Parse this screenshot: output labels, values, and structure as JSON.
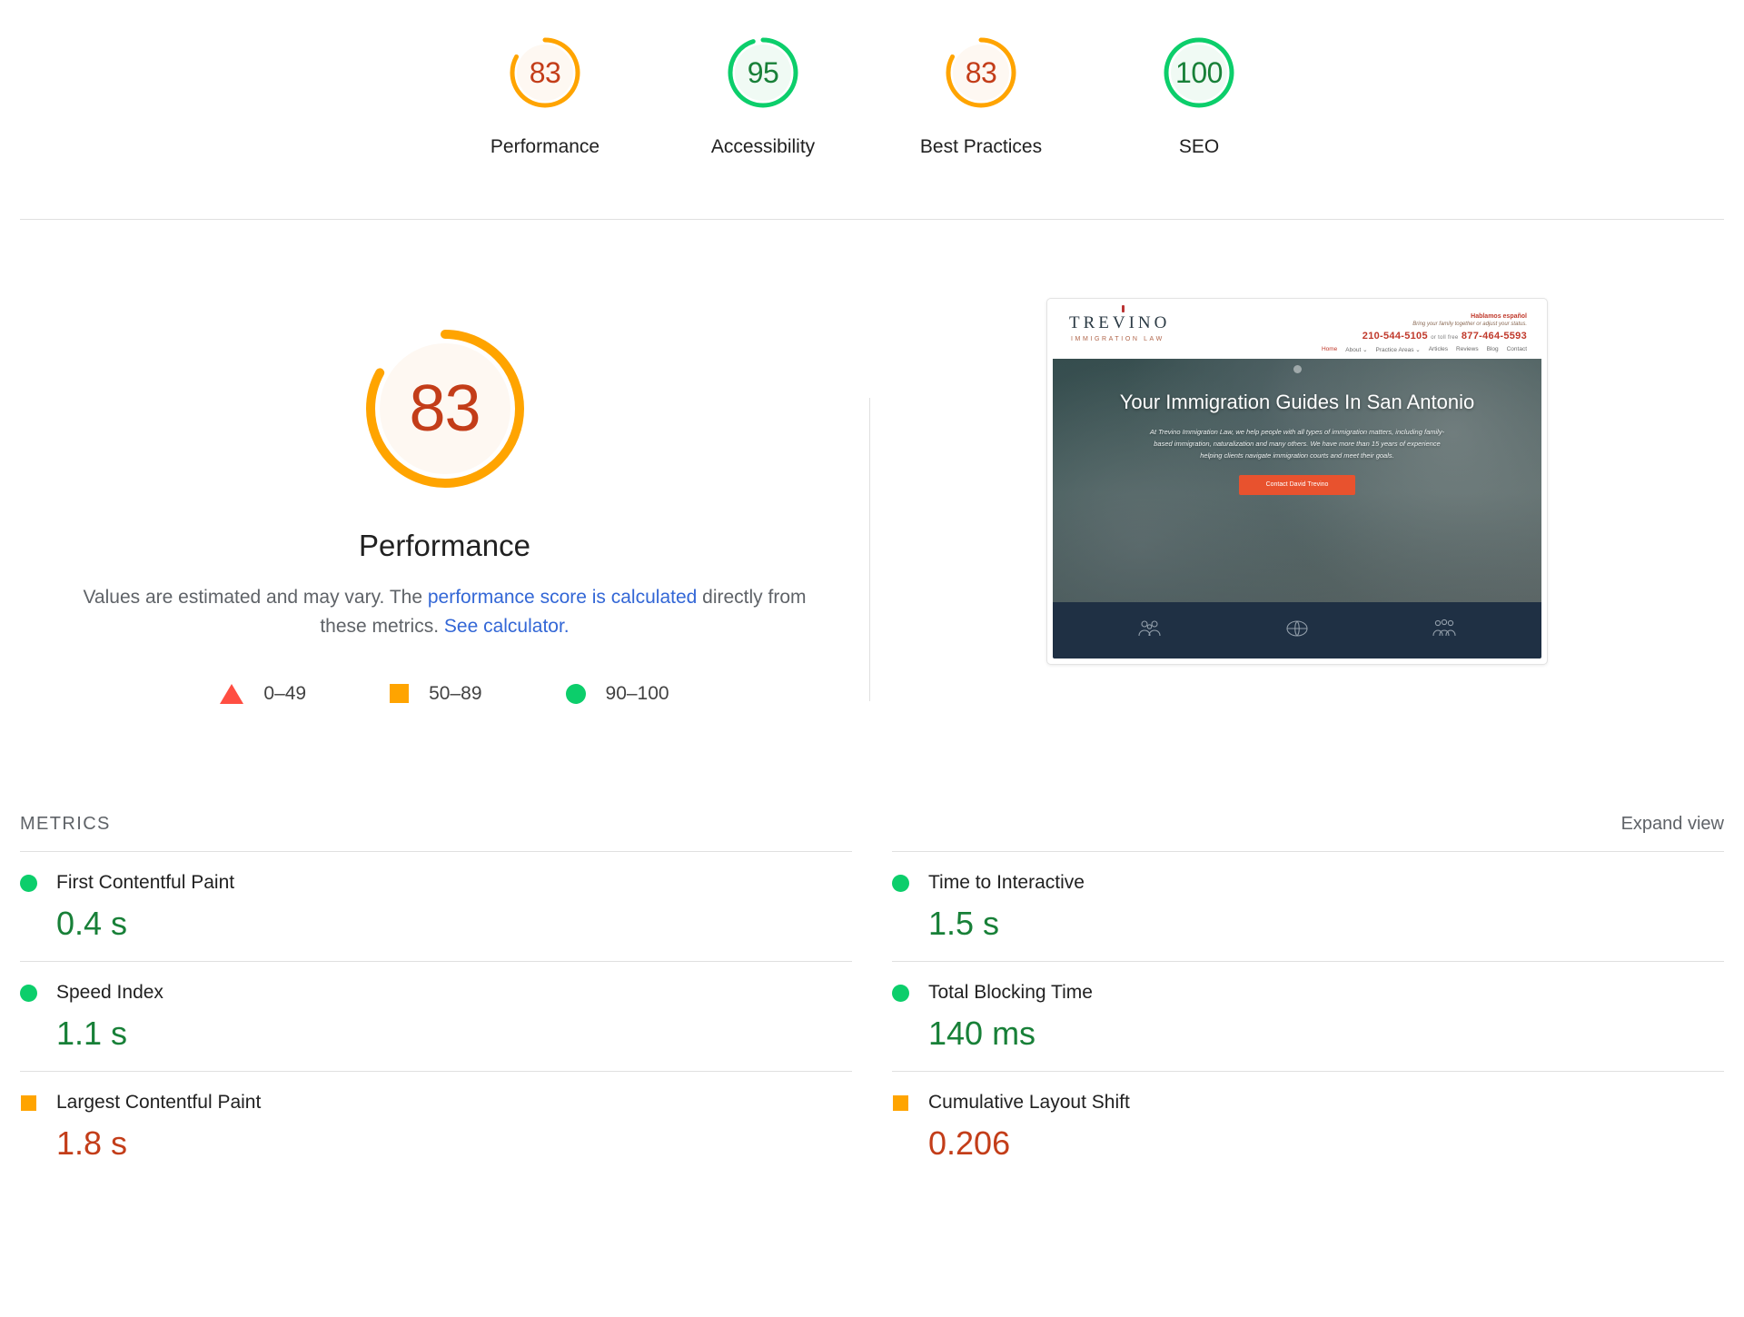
{
  "scores": [
    {
      "value": 83,
      "label": "Performance",
      "status": "average",
      "pct": 83
    },
    {
      "value": 95,
      "label": "Accessibility",
      "status": "pass",
      "pct": 95
    },
    {
      "value": 83,
      "label": "Best Practices",
      "status": "average",
      "pct": 83
    },
    {
      "value": 100,
      "label": "SEO",
      "status": "pass",
      "pct": 100
    }
  ],
  "performance": {
    "value": 83,
    "title": "Performance",
    "desc_part1": "Values are estimated and may vary. The ",
    "link1": "performance score is calculated",
    "desc_part2": " directly from these metrics. ",
    "link2": "See calculator.",
    "legend": [
      {
        "shape": "triangle",
        "range": "0–49",
        "color": "#ff4e42"
      },
      {
        "shape": "square",
        "range": "50–89",
        "color": "#ffa400"
      },
      {
        "shape": "circle",
        "range": "90–100",
        "color": "#0cce6b"
      }
    ]
  },
  "thumbnail": {
    "logo": "TREVINO",
    "logo_sub": "IMMIGRATION LAW",
    "hablamos": "Hablamos español",
    "tagline1": "Bring your family together or adjust your status.",
    "phone_primary": "210-544-5105",
    "phone_tollfree_label": "or toll free",
    "phone_tollfree": "877-464-5593",
    "nav": [
      "Home",
      "About ⌄",
      "Practice Areas ⌄",
      "Articles",
      "Reviews",
      "Blog",
      "Contact"
    ],
    "hero_title": "Your Immigration Guides In San Antonio",
    "hero_paragraph": "At Trevino Immigration Law, we help people with all types of immigration matters, including family-based immigration, naturalization and many others. We have more than 15 years of experience helping clients navigate immigration courts and meet their goals.",
    "cta": "Contact David Trevino"
  },
  "metrics_section": {
    "title": "METRICS",
    "expand_view": "Expand view"
  },
  "metrics": [
    {
      "name": "First Contentful Paint",
      "value": "0.4 s",
      "status": "pass"
    },
    {
      "name": "Time to Interactive",
      "value": "1.5 s",
      "status": "pass"
    },
    {
      "name": "Speed Index",
      "value": "1.1 s",
      "status": "pass"
    },
    {
      "name": "Total Blocking Time",
      "value": "140 ms",
      "status": "pass"
    },
    {
      "name": "Largest Contentful Paint",
      "value": "1.8 s",
      "status": "average"
    },
    {
      "name": "Cumulative Layout Shift",
      "value": "0.206",
      "status": "average"
    }
  ],
  "colors": {
    "pass": "#0cce6b",
    "average": "#ffa400",
    "fail": "#ff4e42",
    "pass_text": "#188038",
    "average_text": "#c33d19",
    "link": "#3367d6"
  }
}
